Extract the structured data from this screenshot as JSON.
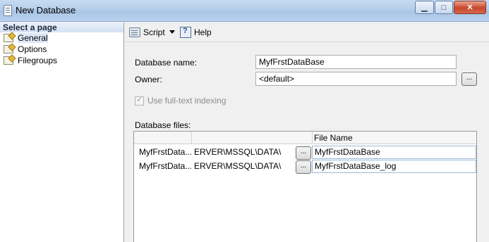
{
  "window": {
    "title": "New Database"
  },
  "controls": {
    "minimize": "▁",
    "maximize": "□",
    "close": "✕"
  },
  "left_pane": {
    "header": "Select a page",
    "items": [
      {
        "label": "General",
        "icon": "page-icon"
      },
      {
        "label": "Options",
        "icon": "page-icon"
      },
      {
        "label": "Filegroups",
        "icon": "page-icon"
      }
    ]
  },
  "toolbar": {
    "script_label": "Script",
    "help_label": "Help"
  },
  "form": {
    "db_name_label": "Database name:",
    "db_name_value": "MyfFrstDataBase",
    "owner_label": "Owner:",
    "owner_value": "<default>",
    "browse_label": "...",
    "fulltext_label": "Use full-text indexing",
    "db_files_label": "Database files:"
  },
  "grid": {
    "headers": {
      "logical_name": "",
      "path": "",
      "file_name": "File Name"
    },
    "rows": [
      {
        "logical_name": "MyfFrstData...",
        "path": "ERVER\\MSSQL\\DATA\\",
        "browse": "...",
        "file_name": "MyfFrstDataBase"
      },
      {
        "logical_name": "MyfFrstData...",
        "path": "ERVER\\MSSQL\\DATA\\",
        "browse": "...",
        "file_name": "MyfFrstDataBase_log"
      }
    ]
  }
}
